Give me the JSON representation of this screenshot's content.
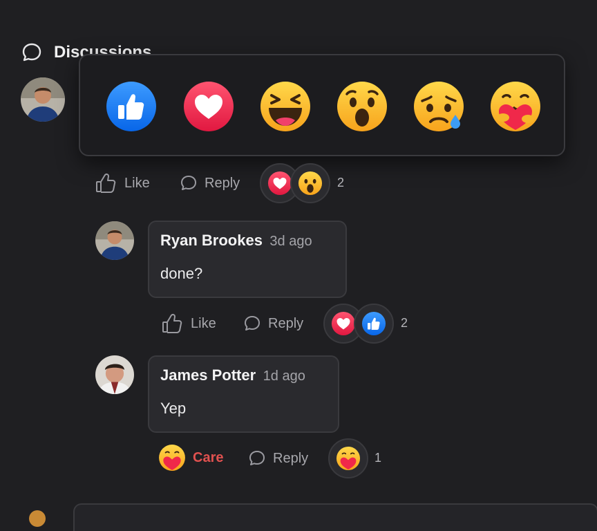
{
  "section": {
    "title": "Discussions"
  },
  "picker": {
    "reactions": [
      {
        "name": "like",
        "icon": "like-reaction-icon"
      },
      {
        "name": "love",
        "icon": "love-reaction-icon"
      },
      {
        "name": "haha",
        "icon": "haha-reaction-icon"
      },
      {
        "name": "wow",
        "icon": "wow-reaction-icon"
      },
      {
        "name": "sad",
        "icon": "sad-reaction-icon"
      },
      {
        "name": "care",
        "icon": "care-reaction-icon"
      }
    ]
  },
  "thread": {
    "root_actions": {
      "like_label": "Like",
      "reply_label": "Reply",
      "reaction_count": "2"
    },
    "comments": [
      {
        "author": "Ryan Brookes",
        "time": "3d ago",
        "text": "done?",
        "actions": {
          "like_label": "Like",
          "reply_label": "Reply",
          "reaction_count": "2"
        }
      },
      {
        "author": "James Potter",
        "time": "1d ago",
        "text": "Yep",
        "actions": {
          "like_label": "Care",
          "reply_label": "Reply",
          "reaction_count": "1"
        }
      }
    ]
  },
  "colors": {
    "background": "#1f1f22",
    "bubble": "#2a2a2e",
    "border": "#3a3a3e",
    "like_blue": "#1a7cf2",
    "love_red": "#f0284a",
    "emoji_yellow": "#fdc131",
    "care_red": "#e0514f"
  }
}
